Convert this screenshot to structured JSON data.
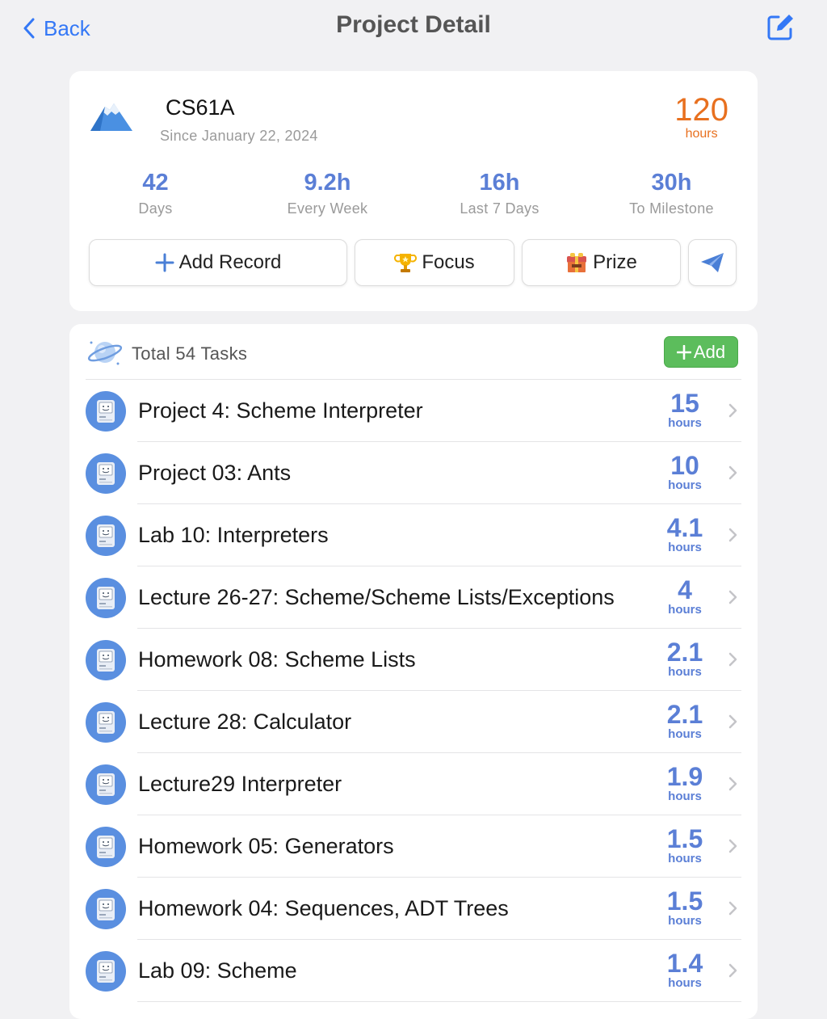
{
  "nav": {
    "back_label": "Back",
    "title": "Project Detail"
  },
  "project": {
    "name": "CS61A",
    "since": "Since January 22, 2024",
    "total_hours": "120",
    "total_hours_unit": "hours",
    "stats": [
      {
        "value": "42",
        "label": "Days"
      },
      {
        "value": "9.2h",
        "label": "Every Week"
      },
      {
        "value": "16h",
        "label": "Last 7 Days"
      },
      {
        "value": "30h",
        "label": "To Milestone"
      }
    ]
  },
  "actions": {
    "add_record": "Add Record",
    "focus": "Focus",
    "prize": "Prize"
  },
  "tasks": {
    "header": "Total 54 Tasks",
    "add_label": "Add",
    "unit": "hours",
    "items": [
      {
        "name": "Project 4: Scheme Interpreter",
        "hours": "15"
      },
      {
        "name": "Project 03: Ants",
        "hours": "10"
      },
      {
        "name": "Lab 10: Interpreters",
        "hours": "4.1"
      },
      {
        "name": "Lecture 26-27: Scheme/Scheme Lists/Exceptions",
        "hours": "4"
      },
      {
        "name": "Homework 08: Scheme Lists",
        "hours": "2.1"
      },
      {
        "name": "Lecture 28: Calculator",
        "hours": "2.1"
      },
      {
        "name": "Lecture29 Interpreter",
        "hours": "1.9"
      },
      {
        "name": "Homework 05: Generators",
        "hours": "1.5"
      },
      {
        "name": "Homework 04: Sequences, ADT Trees",
        "hours": "1.5"
      },
      {
        "name": "Lab 09: Scheme",
        "hours": "1.4"
      }
    ]
  },
  "colors": {
    "accent_blue": "#3478f6",
    "stat_blue": "#5b7fd6",
    "orange": "#e8701f",
    "green": "#5cbd5c"
  },
  "icons": {
    "back": "chevron-left-icon",
    "edit": "edit-icon",
    "project": "mountain-icon",
    "add_record": "plus-icon",
    "focus": "trophy-icon",
    "prize": "gift-box-icon",
    "send": "paper-plane-icon",
    "tasks_header": "planet-icon",
    "task": "computer-icon",
    "row_chevron": "chevron-right-icon"
  }
}
